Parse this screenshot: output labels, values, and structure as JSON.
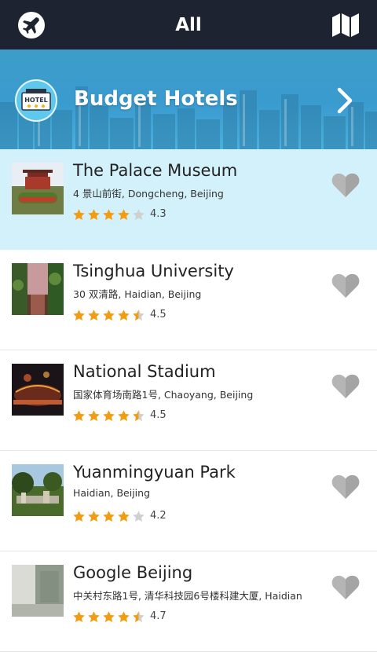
{
  "header": {
    "title": "All",
    "left_icon": "airplane-icon",
    "right_icon": "map-icon"
  },
  "banner": {
    "label": "Budget Hotels",
    "badge_text": "HOTEL",
    "icon": "hotel-icon",
    "chevron_icon": "chevron-right-icon"
  },
  "colors": {
    "topbar": "#1d2330",
    "banner": "#3a9bcf",
    "selected_row": "#d3f1fb",
    "star_filled": "#f39c12",
    "star_empty": "#d0d0d0",
    "heart": "#b5b5b5"
  },
  "places": [
    {
      "name": "The Palace Museum",
      "address": "4 景山前街, Dongcheng, Beijing",
      "rating": "4.3",
      "rating_value": 4.3,
      "selected": true
    },
    {
      "name": "Tsinghua University",
      "address": "30 双清路, Haidian, Beijing",
      "rating": "4.5",
      "rating_value": 4.5,
      "selected": false
    },
    {
      "name": "National Stadium",
      "address": "国家体育场南路1号, Chaoyang, Beijing",
      "rating": "4.5",
      "rating_value": 4.5,
      "selected": false
    },
    {
      "name": "Yuanmingyuan Park",
      "address": "Haidian, Beijing",
      "rating": "4.2",
      "rating_value": 4.2,
      "selected": false
    },
    {
      "name": "Google Beijing",
      "address": "中关村东路1号, 清华科技园6号楼科建大厦, Haidian",
      "rating": "4.7",
      "rating_value": 4.7,
      "selected": false
    }
  ]
}
